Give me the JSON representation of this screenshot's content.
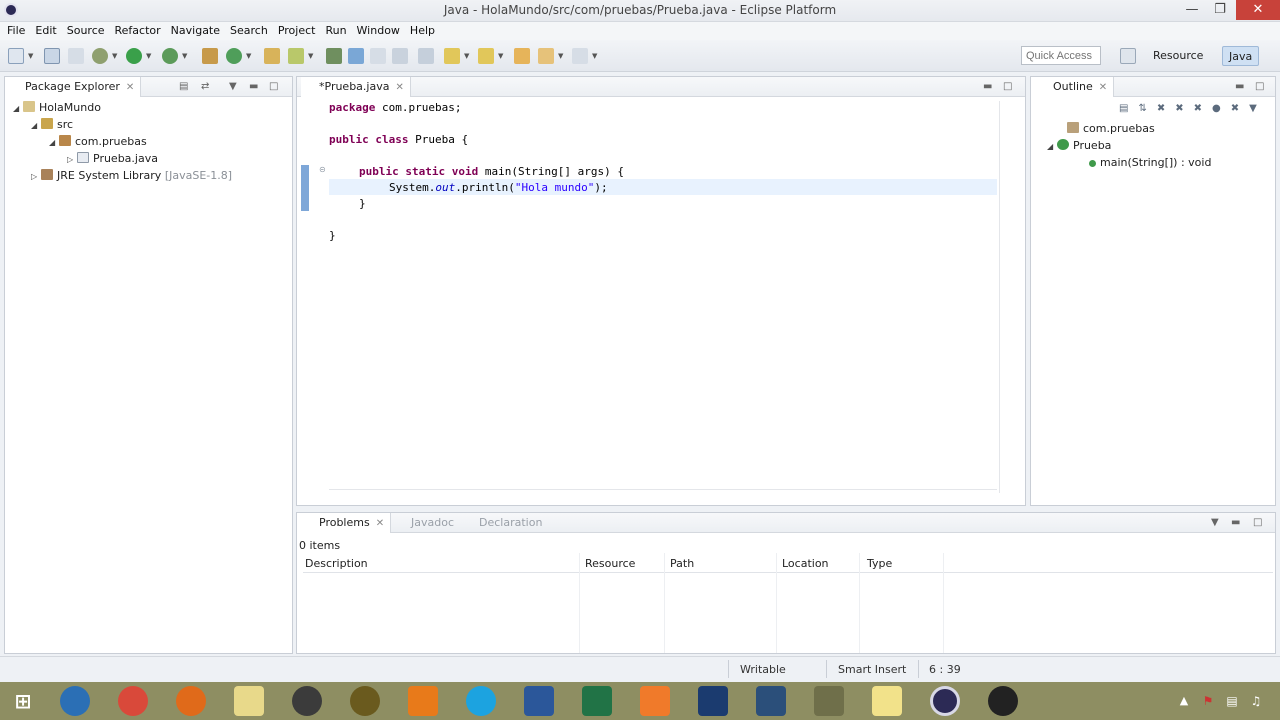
{
  "window": {
    "title": "Java - HolaMundo/src/com/pruebas/Prueba.java - Eclipse Platform"
  },
  "menu": [
    "File",
    "Edit",
    "Source",
    "Refactor",
    "Navigate",
    "Search",
    "Project",
    "Run",
    "Window",
    "Help"
  ],
  "toolbar": {
    "quick_access_placeholder": "Quick Access",
    "perspective_resource": "Resource",
    "perspective_java": "Java"
  },
  "package_explorer": {
    "tab_label": "Package Explorer",
    "tree": [
      {
        "label": "HolaMundo"
      },
      {
        "label": "src"
      },
      {
        "label": "com.pruebas"
      },
      {
        "label": "Prueba.java"
      },
      {
        "label": "JRE System Library",
        "suffix": "[JavaSE-1.8]"
      }
    ]
  },
  "editor": {
    "tab_label": "*Prueba.java",
    "lines": {
      "l1_kw": "package",
      "l1_rest": " com.pruebas;",
      "l3_kw1": "public",
      "l3_kw2": "class",
      "l3_rest": " Prueba {",
      "l5_kw1": "public",
      "l5_kw2": "static",
      "l5_kw3": "void",
      "l5_rest": " main(String[] args) {",
      "l6_a": "System.",
      "l6_fld": "out",
      "l6_b": ".println(",
      "l6_str": "\"Hola mundo\"",
      "l6_c": ");",
      "l7": "}",
      "l9": "}"
    }
  },
  "outline": {
    "tab_label": "Outline",
    "items": [
      {
        "label": "com.pruebas"
      },
      {
        "label": "Prueba"
      },
      {
        "label": "main(String[]) : void"
      }
    ]
  },
  "problems": {
    "tabs": [
      "Problems",
      "Javadoc",
      "Declaration"
    ],
    "count": "0 items",
    "columns": [
      "Description",
      "Resource",
      "Path",
      "Location",
      "Type"
    ]
  },
  "status": {
    "writable": "Writable",
    "insert_mode": "Smart Insert",
    "position": "6 : 39"
  },
  "colors": {
    "keyword": "#7f0055",
    "string": "#2a00ff",
    "field": "#0000c0",
    "taskbar": "#8e8e62"
  }
}
